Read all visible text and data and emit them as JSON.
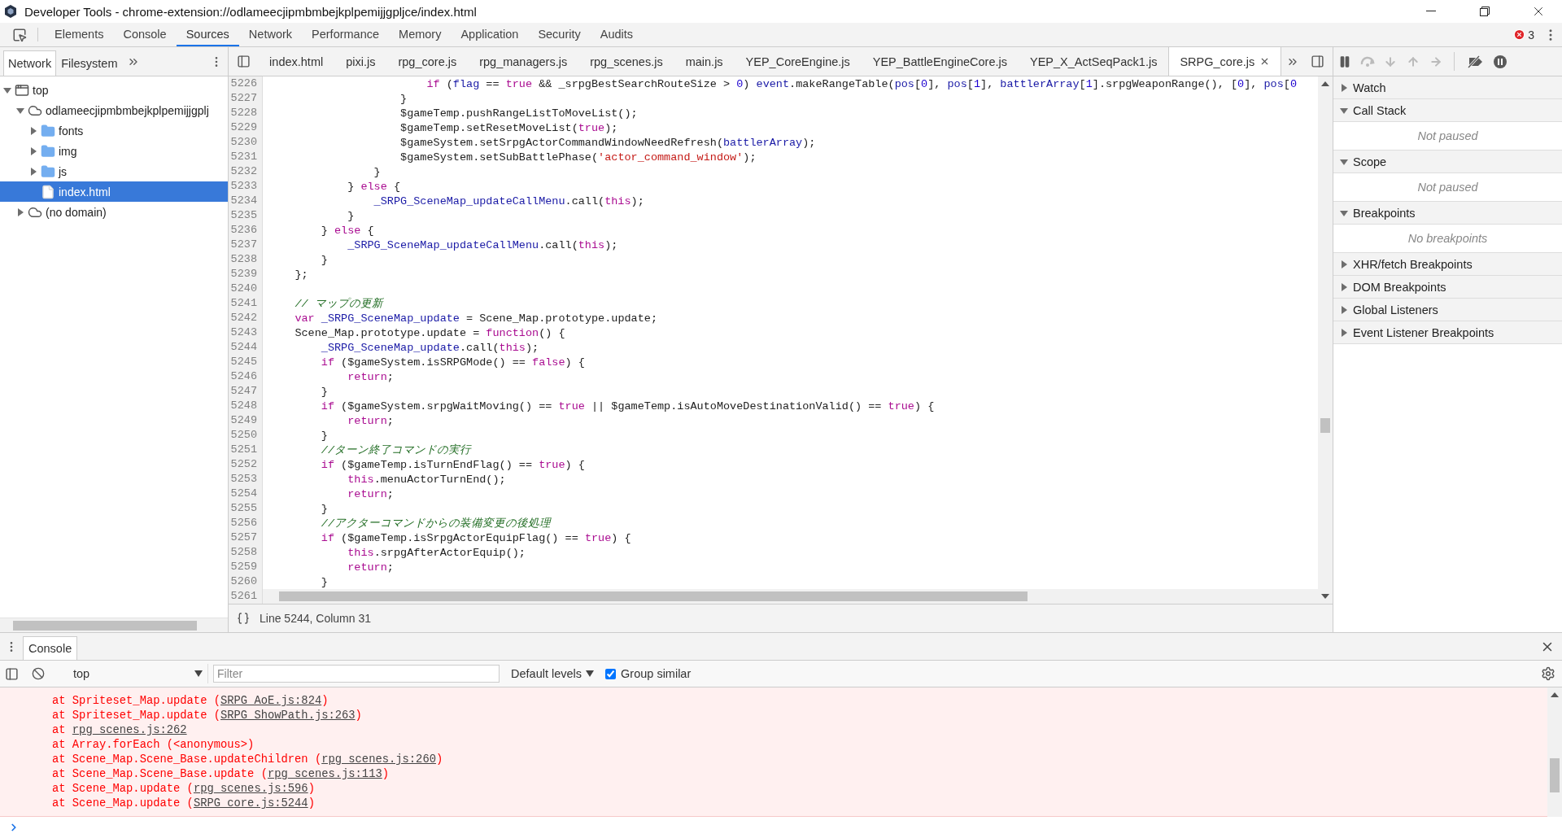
{
  "window": {
    "title": "Developer Tools - chrome-extension://odlameecjipmbmbejkplpemijjgpljce/index.html"
  },
  "main_tabs": [
    {
      "label": "Elements",
      "selected": false
    },
    {
      "label": "Console",
      "selected": false
    },
    {
      "label": "Sources",
      "selected": true
    },
    {
      "label": "Network",
      "selected": false
    },
    {
      "label": "Performance",
      "selected": false
    },
    {
      "label": "Memory",
      "selected": false
    },
    {
      "label": "Application",
      "selected": false
    },
    {
      "label": "Security",
      "selected": false
    },
    {
      "label": "Audits",
      "selected": false
    }
  ],
  "error_count": "3",
  "navigator": {
    "tabs": [
      {
        "label": "Network",
        "selected": true
      },
      {
        "label": "Filesystem",
        "selected": false
      }
    ],
    "tree": [
      {
        "label": "top",
        "kind": "frame",
        "expanded": true,
        "selected": false,
        "children": [
          {
            "label": "odlameecjipmbmbejkplpemijjgplj",
            "kind": "domain",
            "expanded": true,
            "selected": false,
            "children": [
              {
                "label": "fonts",
                "kind": "folder",
                "expanded": false,
                "selected": false
              },
              {
                "label": "img",
                "kind": "folder",
                "expanded": false,
                "selected": false
              },
              {
                "label": "js",
                "kind": "folder",
                "expanded": false,
                "selected": false
              },
              {
                "label": "index.html",
                "kind": "file",
                "selected": true
              }
            ]
          },
          {
            "label": "(no domain)",
            "kind": "domain",
            "expanded": false,
            "selected": false
          }
        ]
      }
    ]
  },
  "editor": {
    "tabs": [
      {
        "label": "index.html",
        "selected": false
      },
      {
        "label": "pixi.js",
        "selected": false
      },
      {
        "label": "rpg_core.js",
        "selected": false
      },
      {
        "label": "rpg_managers.js",
        "selected": false
      },
      {
        "label": "rpg_scenes.js",
        "selected": false
      },
      {
        "label": "main.js",
        "selected": false
      },
      {
        "label": "YEP_CoreEngine.js",
        "selected": false
      },
      {
        "label": "YEP_BattleEngineCore.js",
        "selected": false
      },
      {
        "label": "YEP_X_ActSeqPack1.js",
        "selected": false
      },
      {
        "label": "SRPG_core.js",
        "selected": true
      }
    ],
    "lines": [
      {
        "number": "5226",
        "tokens": [
          {
            "kind": "kw",
            "text": "                        if"
          },
          {
            "kind": "plain",
            "text": " ("
          },
          {
            "kind": "var",
            "text": "flag"
          },
          {
            "kind": "plain",
            "text": " == "
          },
          {
            "kind": "kw",
            "text": "true"
          },
          {
            "kind": "plain",
            "text": " && _srpgBestSearchRouteSize > "
          },
          {
            "kind": "num",
            "text": "0"
          },
          {
            "kind": "plain",
            "text": ") "
          },
          {
            "kind": "var",
            "text": "event"
          },
          {
            "kind": "plain",
            "text": ".makeRangeTable("
          },
          {
            "kind": "var",
            "text": "pos"
          },
          {
            "kind": "plain",
            "text": "["
          },
          {
            "kind": "num",
            "text": "0"
          },
          {
            "kind": "plain",
            "text": "], "
          },
          {
            "kind": "var",
            "text": "pos"
          },
          {
            "kind": "plain",
            "text": "["
          },
          {
            "kind": "num",
            "text": "1"
          },
          {
            "kind": "plain",
            "text": "], "
          },
          {
            "kind": "var",
            "text": "battlerArray"
          },
          {
            "kind": "plain",
            "text": "["
          },
          {
            "kind": "num",
            "text": "1"
          },
          {
            "kind": "plain",
            "text": "].srpgWeaponRange(), ["
          },
          {
            "kind": "num",
            "text": "0"
          },
          {
            "kind": "plain",
            "text": "], "
          },
          {
            "kind": "var",
            "text": "pos"
          },
          {
            "kind": "plain",
            "text": "["
          },
          {
            "kind": "num",
            "text": "0"
          }
        ]
      },
      {
        "number": "5227",
        "tokens": [
          {
            "kind": "plain",
            "text": "                    }"
          }
        ]
      },
      {
        "number": "5228",
        "tokens": [
          {
            "kind": "plain",
            "text": "                    $gameTemp.pushRangeListToMoveList();"
          }
        ]
      },
      {
        "number": "5229",
        "tokens": [
          {
            "kind": "plain",
            "text": "                    $gameTemp.setResetMoveList("
          },
          {
            "kind": "kw",
            "text": "true"
          },
          {
            "kind": "plain",
            "text": ");"
          }
        ]
      },
      {
        "number": "5230",
        "tokens": [
          {
            "kind": "plain",
            "text": "                    $gameSystem.setSrpgActorCommandWindowNeedRefresh("
          },
          {
            "kind": "var",
            "text": "battlerArray"
          },
          {
            "kind": "plain",
            "text": ");"
          }
        ]
      },
      {
        "number": "5231",
        "tokens": [
          {
            "kind": "plain",
            "text": "                    $gameSystem.setSubBattlePhase("
          },
          {
            "kind": "str",
            "text": "'actor_command_window'"
          },
          {
            "kind": "plain",
            "text": ");"
          }
        ]
      },
      {
        "number": "5232",
        "tokens": [
          {
            "kind": "plain",
            "text": "                }"
          }
        ]
      },
      {
        "number": "5233",
        "tokens": [
          {
            "kind": "plain",
            "text": "            } "
          },
          {
            "kind": "kw",
            "text": "else"
          },
          {
            "kind": "plain",
            "text": " {"
          }
        ]
      },
      {
        "number": "5234",
        "tokens": [
          {
            "kind": "var",
            "text": "                _SRPG_SceneMap_updateCallMenu"
          },
          {
            "kind": "plain",
            "text": ".call("
          },
          {
            "kind": "kw",
            "text": "this"
          },
          {
            "kind": "plain",
            "text": ");"
          }
        ]
      },
      {
        "number": "5235",
        "tokens": [
          {
            "kind": "plain",
            "text": "            }"
          }
        ]
      },
      {
        "number": "5236",
        "tokens": [
          {
            "kind": "plain",
            "text": "        } "
          },
          {
            "kind": "kw",
            "text": "else"
          },
          {
            "kind": "plain",
            "text": " {"
          }
        ]
      },
      {
        "number": "5237",
        "tokens": [
          {
            "kind": "var",
            "text": "            _SRPG_SceneMap_updateCallMenu"
          },
          {
            "kind": "plain",
            "text": ".call("
          },
          {
            "kind": "kw",
            "text": "this"
          },
          {
            "kind": "plain",
            "text": ");"
          }
        ]
      },
      {
        "number": "5238",
        "tokens": [
          {
            "kind": "plain",
            "text": "        }"
          }
        ]
      },
      {
        "number": "5239",
        "tokens": [
          {
            "kind": "plain",
            "text": "    };"
          }
        ]
      },
      {
        "number": "5240"
      },
      {
        "number": "5241",
        "tokens": [
          {
            "kind": "cm",
            "text": "    // マップの更新"
          }
        ]
      },
      {
        "number": "5242",
        "tokens": [
          {
            "kind": "kw",
            "text": "    var"
          },
          {
            "kind": "var",
            "text": " _SRPG_SceneMap_update"
          },
          {
            "kind": "plain",
            "text": " = Scene_Map.prototype.update;"
          }
        ]
      },
      {
        "number": "5243",
        "tokens": [
          {
            "kind": "plain",
            "text": "    Scene_Map.prototype.update = "
          },
          {
            "kind": "kw",
            "text": "function"
          },
          {
            "kind": "plain",
            "text": "() {"
          }
        ]
      },
      {
        "number": "5244",
        "tokens": [
          {
            "kind": "var",
            "text": "        _SRPG_SceneMap_update"
          },
          {
            "kind": "plain",
            "text": ".call("
          },
          {
            "kind": "kw",
            "text": "this"
          },
          {
            "kind": "plain",
            "text": ");"
          }
        ]
      },
      {
        "number": "5245",
        "tokens": [
          {
            "kind": "kw",
            "text": "        if"
          },
          {
            "kind": "plain",
            "text": " ($gameSystem.isSRPGMode() == "
          },
          {
            "kind": "kw",
            "text": "false"
          },
          {
            "kind": "plain",
            "text": ") {"
          }
        ]
      },
      {
        "number": "5246",
        "tokens": [
          {
            "kind": "kw",
            "text": "            return"
          },
          {
            "kind": "plain",
            "text": ";"
          }
        ]
      },
      {
        "number": "5247",
        "tokens": [
          {
            "kind": "plain",
            "text": "        }"
          }
        ]
      },
      {
        "number": "5248",
        "tokens": [
          {
            "kind": "kw",
            "text": "        if"
          },
          {
            "kind": "plain",
            "text": " ($gameSystem.srpgWaitMoving() == "
          },
          {
            "kind": "kw",
            "text": "true"
          },
          {
            "kind": "plain",
            "text": " || $gameTemp.isAutoMoveDestinationValid() == "
          },
          {
            "kind": "kw",
            "text": "true"
          },
          {
            "kind": "plain",
            "text": ") {"
          }
        ]
      },
      {
        "number": "5249",
        "tokens": [
          {
            "kind": "kw",
            "text": "            return"
          },
          {
            "kind": "plain",
            "text": ";"
          }
        ]
      },
      {
        "number": "5250",
        "tokens": [
          {
            "kind": "plain",
            "text": "        }"
          }
        ]
      },
      {
        "number": "5251",
        "tokens": [
          {
            "kind": "cm",
            "text": "        //ターン終了コマンドの実行"
          }
        ]
      },
      {
        "number": "5252",
        "tokens": [
          {
            "kind": "kw",
            "text": "        if"
          },
          {
            "kind": "plain",
            "text": " ($gameTemp.isTurnEndFlag() == "
          },
          {
            "kind": "kw",
            "text": "true"
          },
          {
            "kind": "plain",
            "text": ") {"
          }
        ]
      },
      {
        "number": "5253",
        "tokens": [
          {
            "kind": "kw",
            "text": "            this"
          },
          {
            "kind": "plain",
            "text": ".menuActorTurnEnd();"
          }
        ]
      },
      {
        "number": "5254",
        "tokens": [
          {
            "kind": "kw",
            "text": "            return"
          },
          {
            "kind": "plain",
            "text": ";"
          }
        ]
      },
      {
        "number": "5255",
        "tokens": [
          {
            "kind": "plain",
            "text": "        }"
          }
        ]
      },
      {
        "number": "5256",
        "tokens": [
          {
            "kind": "cm",
            "text": "        //アクターコマンドからの装備変更の後処理"
          }
        ]
      },
      {
        "number": "5257",
        "tokens": [
          {
            "kind": "kw",
            "text": "        if"
          },
          {
            "kind": "plain",
            "text": " ($gameTemp.isSrpgActorEquipFlag() == "
          },
          {
            "kind": "kw",
            "text": "true"
          },
          {
            "kind": "plain",
            "text": ") {"
          }
        ]
      },
      {
        "number": "5258",
        "tokens": [
          {
            "kind": "kw",
            "text": "            this"
          },
          {
            "kind": "plain",
            "text": ".srpgAfterActorEquip();"
          }
        ]
      },
      {
        "number": "5259",
        "tokens": [
          {
            "kind": "kw",
            "text": "            return"
          },
          {
            "kind": "plain",
            "text": ";"
          }
        ]
      },
      {
        "number": "5260",
        "tokens": [
          {
            "kind": "plain",
            "text": "        }"
          }
        ]
      },
      {
        "number": "5261"
      }
    ],
    "status": "Line 5244, Column 31"
  },
  "debugger": {
    "buttons": [
      {
        "kind": "pause",
        "disabled": false
      },
      {
        "kind": "step-over",
        "disabled": true
      },
      {
        "kind": "step-into",
        "disabled": true
      },
      {
        "kind": "step-out",
        "disabled": true
      },
      {
        "kind": "step",
        "disabled": true
      },
      {
        "kind": "deactivate",
        "disabled": false
      },
      {
        "kind": "exceptions",
        "disabled": false
      }
    ],
    "sections": [
      {
        "title": "Watch",
        "expanded": false
      },
      {
        "title": "Call Stack",
        "expanded": true,
        "body": "Not paused"
      },
      {
        "title": "Scope",
        "expanded": true,
        "body": "Not paused"
      },
      {
        "title": "Breakpoints",
        "expanded": true,
        "body": "No breakpoints"
      },
      {
        "title": "XHR/fetch Breakpoints",
        "expanded": false
      },
      {
        "title": "DOM Breakpoints",
        "expanded": false
      },
      {
        "title": "Global Listeners",
        "expanded": false
      },
      {
        "title": "Event Listener Breakpoints",
        "expanded": false
      }
    ]
  },
  "drawer": {
    "tabs": [
      {
        "label": "Console",
        "selected": true
      }
    ],
    "context": "top",
    "filter": {
      "placeholder": "Filter"
    },
    "levels": "Default levels",
    "group_similar": {
      "label": "Group similar",
      "checked": true
    },
    "log": [
      {
        "prefix": "at Spriteset_Map.update (",
        "link": "SRPG_AoE.js:824",
        "suffix": ")"
      },
      {
        "prefix": "at Spriteset_Map.update (",
        "link": "SRPG_ShowPath.js:263",
        "suffix": ")"
      },
      {
        "prefix": "at ",
        "link": "rpg_scenes.js:262"
      },
      {
        "prefix": "at Array.forEach (<anonymous>)"
      },
      {
        "prefix": "at Scene_Map.Scene_Base.updateChildren (",
        "link": "rpg_scenes.js:260",
        "suffix": ")"
      },
      {
        "prefix": "at Scene_Map.Scene_Base.update (",
        "link": "rpg_scenes.js:113",
        "suffix": ")"
      },
      {
        "prefix": "at Scene_Map.update (",
        "link": "rpg_scenes.js:596",
        "suffix": ")"
      },
      {
        "prefix": "at Scene_Map.update (",
        "link": "SRPG_core.js:5244",
        "suffix": ")"
      }
    ]
  }
}
